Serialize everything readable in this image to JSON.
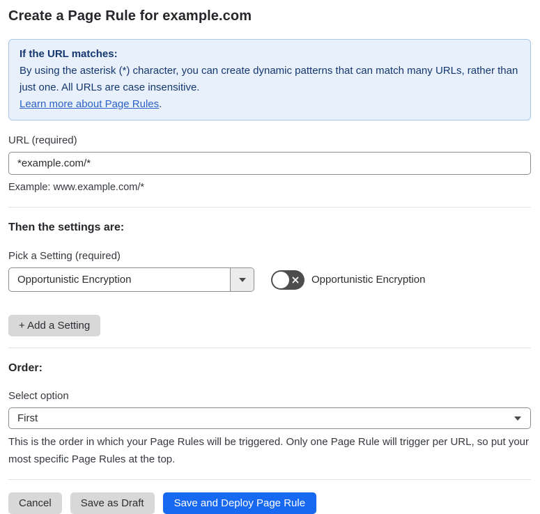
{
  "page": {
    "title": "Create a Page Rule for example.com"
  },
  "info_box": {
    "heading": "If the URL matches:",
    "body": "By using the asterisk (*) character, you can create dynamic patterns that can match many URLs, rather than just one. All URLs are case insensitive.",
    "link_label": "Learn more about Page Rules",
    "link_suffix": "."
  },
  "url_field": {
    "label": "URL (required)",
    "value": "*example.com/*",
    "example": "Example: www.example.com/*"
  },
  "settings_section": {
    "heading": "Then the settings are:",
    "picker_label": "Pick a Setting (required)",
    "selected_setting": "Opportunistic Encryption",
    "toggle_state": "off",
    "toggle_label": "Opportunistic Encryption",
    "add_setting_label": "+ Add a Setting"
  },
  "order_section": {
    "heading": "Order:",
    "select_label": "Select option",
    "selected_option": "First",
    "help_text": "This is the order in which your Page Rules will be triggered. Only one Page Rule will trigger per URL, so put your most specific Page Rules at the top."
  },
  "footer": {
    "cancel_label": "Cancel",
    "save_draft_label": "Save as Draft",
    "save_deploy_label": "Save and Deploy Page Rule"
  },
  "colors": {
    "info_background": "#e8f1fb",
    "info_border": "#a9c6e8",
    "info_text": "#15366e",
    "link_blue": "#2c61c7",
    "primary_button_blue": "#1769f2",
    "toggle_off_background": "#4d4d4d",
    "gray_button": "#d8d8d8",
    "input_border": "#8d8d8d"
  },
  "icons": {
    "dropdown_arrow": "triangle-down",
    "select_chevron": "triangle-down",
    "toggle_off": "x-mark"
  }
}
